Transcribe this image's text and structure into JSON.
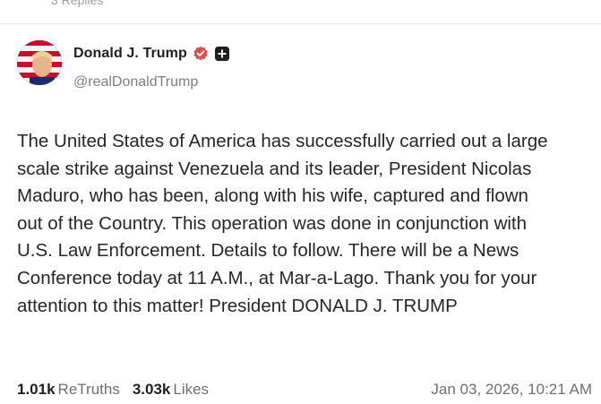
{
  "top_fragment": "3 Replies",
  "author": {
    "display_name": "Donald J. Trump",
    "handle": "@realDonaldTrump",
    "verified_icon": "verified-check-icon",
    "badge_icon": "plus-badge-icon",
    "verified_color": "#d9534f"
  },
  "post": {
    "text": "The United States of America has successfully carried out a large\nscale strike against Venezuela and its leader, President Nicolas\nMaduro, who has been, along with his wife, captured and flown\nout of the Country. This operation was done in conjunction with\nU.S. Law Enforcement. Details to follow. There will be a News\nConference today at 11 A.M., at Mar-a-Lago. Thank you for your\nattention to this matter! President DONALD J. TRUMP"
  },
  "stats": {
    "retruths_count": "1.01k",
    "retruths_label": "ReTruths",
    "likes_count": "3.03k",
    "likes_label": "Likes"
  },
  "timestamp": "Jan 03, 2026, 10:21 AM"
}
